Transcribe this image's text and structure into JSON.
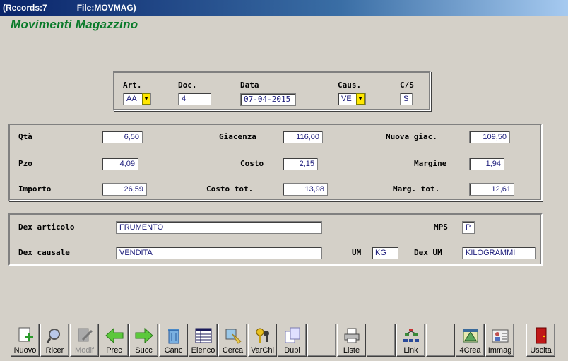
{
  "window": {
    "records": "(Records:7",
    "file": "File:MOVMAG)"
  },
  "app_title": "Movimenti Magazzino",
  "header": {
    "art": {
      "label": "Art.",
      "value": "AA"
    },
    "doc": {
      "label": "Doc.",
      "value": "4"
    },
    "data": {
      "label": "Data",
      "value": "07-04-2015"
    },
    "caus": {
      "label": "Caus.",
      "value": "VE"
    },
    "cs": {
      "label": "C/S",
      "value": "S"
    }
  },
  "values": {
    "qta": {
      "label": "Qtà",
      "value": "6,50"
    },
    "giacenza": {
      "label": "Giacenza",
      "value": "116,00"
    },
    "nuova_giac": {
      "label": "Nuova giac.",
      "value": "109,50"
    },
    "pzo": {
      "label": "Pzo",
      "value": "4,09"
    },
    "costo": {
      "label": "Costo",
      "value": "2,15"
    },
    "margine": {
      "label": "Margine",
      "value": "1,94"
    },
    "importo": {
      "label": "Importo",
      "value": "26,59"
    },
    "costo_tot": {
      "label": "Costo tot.",
      "value": "13,98"
    },
    "marg_tot": {
      "label": "Marg. tot.",
      "value": "12,61"
    }
  },
  "descr": {
    "dex_articolo": {
      "label": "Dex articolo",
      "value": "FRUMENTO"
    },
    "mps": {
      "label": "MPS",
      "value": "P"
    },
    "dex_causale": {
      "label": "Dex causale",
      "value": "VENDITA"
    },
    "um": {
      "label": "UM",
      "value": "KG"
    },
    "dex_um": {
      "label": "Dex UM",
      "value": "KILOGRAMMI"
    }
  },
  "toolbar": [
    {
      "label": "Nuovo",
      "icon": "new-document-icon"
    },
    {
      "label": "Ricer",
      "icon": "magnifier-icon"
    },
    {
      "label": "Modif",
      "icon": "edit-document-icon",
      "disabled": true
    },
    {
      "label": "Prec",
      "icon": "arrow-left-icon"
    },
    {
      "label": "Succ",
      "icon": "arrow-right-icon"
    },
    {
      "label": "Canc",
      "icon": "trash-icon"
    },
    {
      "label": "Elenco",
      "icon": "table-icon"
    },
    {
      "label": "Cerca",
      "icon": "search-filter-icon"
    },
    {
      "label": "VarChi",
      "icon": "keys-icon"
    },
    {
      "label": "Dupl",
      "icon": "duplicate-icon"
    },
    {
      "label": "",
      "icon": ""
    },
    {
      "label": "Liste",
      "icon": "printer-icon"
    },
    {
      "label": "",
      "icon": ""
    },
    {
      "label": "Link",
      "icon": "link-icon"
    },
    {
      "label": "",
      "icon": ""
    },
    {
      "label": "4Crea",
      "icon": "create-icon"
    },
    {
      "label": "Immag",
      "icon": "image-card-icon"
    },
    {
      "label": "Uscita",
      "icon": "exit-door-icon"
    }
  ],
  "colors": {
    "title_green": "#0a7a2a",
    "field_text": "#1a1a7a",
    "dropdown_yellow": "#ffe600"
  }
}
